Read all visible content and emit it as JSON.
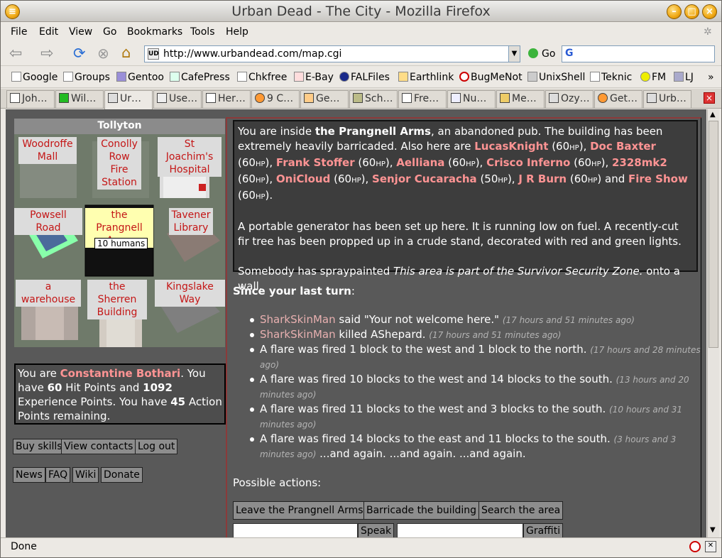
{
  "window": {
    "title": "Urban Dead - The City - Mozilla Firefox"
  },
  "menu": [
    "File",
    "Edit",
    "View",
    "Go",
    "Bookmarks",
    "Tools",
    "Help"
  ],
  "nav": {
    "url": "http://www.urbandead.com/map.cgi",
    "go_label": "Go"
  },
  "bookmarks": [
    "Google",
    "Groups",
    "Gentoo",
    "CafePress",
    "Chkfree",
    "E-Bay",
    "FALFiles",
    "Earthlink",
    "BugMeNot",
    "UnixShell",
    "Teknic",
    "FM",
    "LJ"
  ],
  "tabs": [
    "Joh…",
    "Wil…",
    "Ur…",
    "Use…",
    "Her…",
    "9 C…",
    "Ge…",
    "Sch…",
    "Fre…",
    "Nu…",
    "Me…",
    "Ozy…",
    "Get…",
    "Urb…"
  ],
  "map": {
    "suburb": "Tollyton",
    "cells": [
      "Woodroffe Mall",
      "Conolly Row Fire Station",
      "St Joachim's Hospital",
      "Powsell Road",
      "the Prangnell Arms",
      "Tavener Library",
      "a warehouse",
      "the Sherren Building",
      "Kingslake Way"
    ],
    "humans": "10 humans"
  },
  "player": {
    "p1": "You are ",
    "name": "Constantine Bothari",
    "p2": ". You have ",
    "hp": "60",
    "p3": " Hit Points and ",
    "xp": "1092",
    "p4": " Experience Points. You have ",
    "ap": "45",
    "p5": " Action Points remaining."
  },
  "links1": [
    "Buy skills",
    "View contacts",
    "Log out"
  ],
  "links2": [
    "News",
    "FAQ",
    "Wiki",
    "Donate"
  ],
  "description": {
    "intro": "You are inside ",
    "place": "the Prangnell Arms",
    "rest": ", an abandoned pub. The building has been extremely heavily barricaded. Also here are ",
    "people": [
      {
        "name": "LucasKnight",
        "hp": "60"
      },
      {
        "name": "Doc Baxter",
        "hp": "60"
      },
      {
        "name": "Frank Stoffer",
        "hp": "60"
      },
      {
        "name": "Aelliana",
        "hp": "60"
      },
      {
        "name": "Crisco Inferno",
        "hp": "60"
      },
      {
        "name": "2328mk2",
        "hp": "60"
      },
      {
        "name": "OniCloud",
        "hp": "60"
      },
      {
        "name": "Senjor Cucaracha",
        "hp": "50"
      },
      {
        "name": "J R Burn",
        "hp": "60"
      },
      {
        "name": "Fire Show",
        "hp": "60"
      }
    ],
    "hp_unit": "HP",
    "and_word": "and",
    "para2": "A portable generator has been set up here. It is running low on fuel. A recently-cut fir tree has been propped up in a crude stand, decorated with red and green lights.",
    "graffiti_pre": "Somebody has spraypainted ",
    "graffiti": "This area is part of the Survivor Security Zone.",
    "graffiti_post": " onto a wall."
  },
  "since": "Since your last turn",
  "events": [
    {
      "actor": "SharkSkinMan",
      "text": " said \"Your not welcome here.\"",
      "ago": "(17 hours and 51 minutes ago)"
    },
    {
      "actor": "SharkSkinMan",
      "text": " killed AShepard.",
      "ago": "(17 hours and 51 minutes ago)"
    },
    {
      "actor": "",
      "text": "A flare was fired 1 block to the west and 1 block to the north.",
      "ago": "(17 hours and 28 minutes ago)"
    },
    {
      "actor": "",
      "text": "A flare was fired 10 blocks to the west and 14 blocks to the south.",
      "ago": "(13 hours and 20 minutes ago)"
    },
    {
      "actor": "",
      "text": "A flare was fired 11 blocks to the west and 3 blocks to the south.",
      "ago": "(10 hours and 31 minutes ago)"
    },
    {
      "actor": "",
      "text": "A flare was fired 14 blocks to the east and 11 blocks to the south.",
      "ago": "(3 hours and 3 minutes ago)",
      "tail": " ...and again. ...and again. ...and again."
    }
  ],
  "possible": "Possible actions:",
  "actions": [
    "Leave the Prangnell Arms",
    "Barricade the building",
    "Search the area"
  ],
  "speak_label": "Speak",
  "graffiti_label": "Graffiti",
  "status": "Done"
}
